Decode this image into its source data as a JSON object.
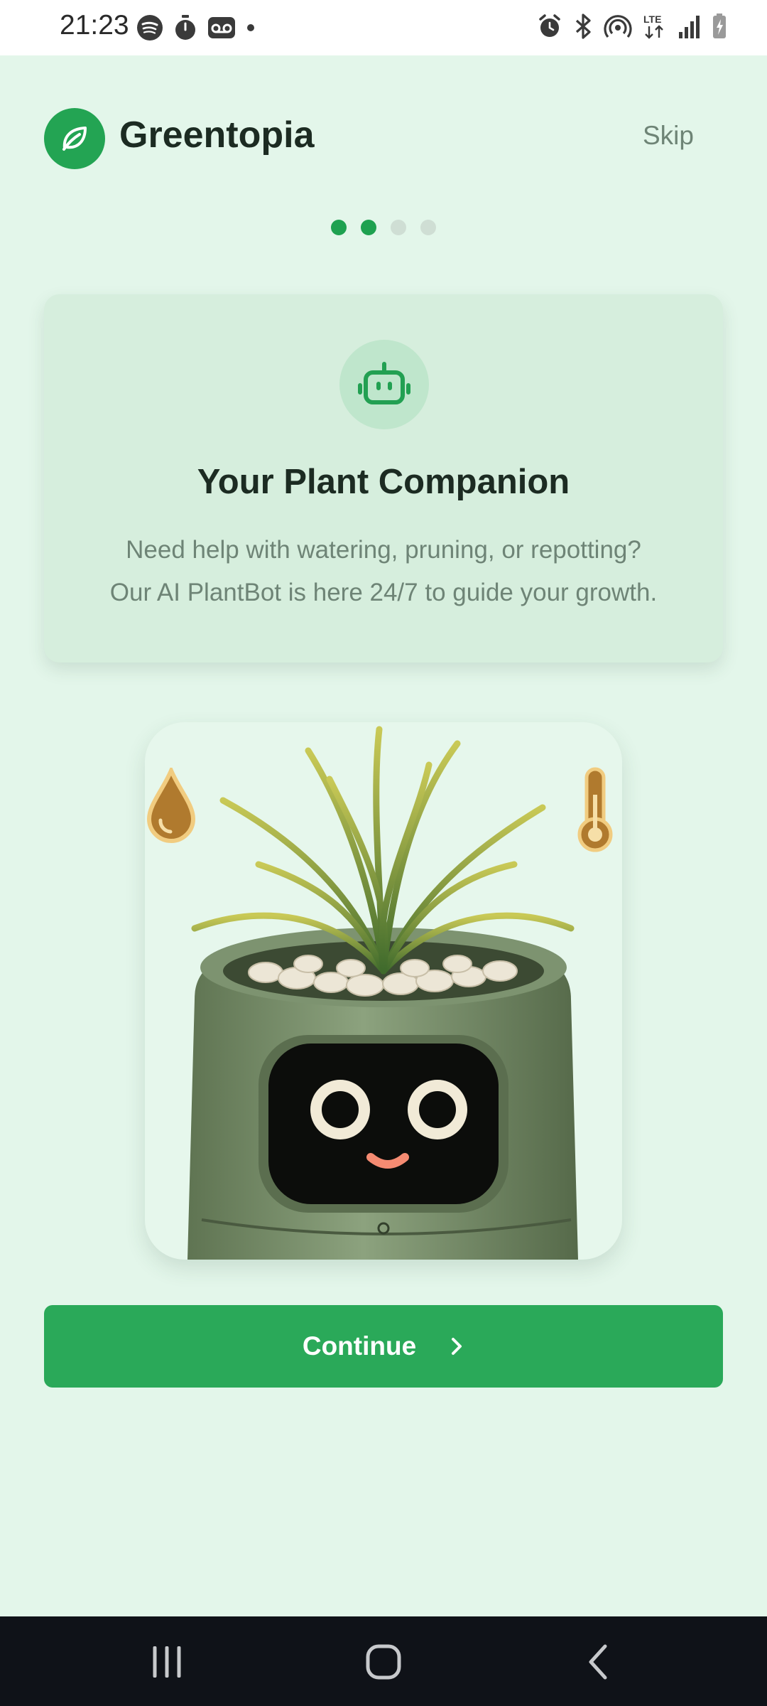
{
  "status_bar": {
    "time": "21:23",
    "left_icons": [
      "spotify-icon",
      "stopwatch-icon",
      "voicemail-icon",
      "dot-icon"
    ],
    "right_icons": [
      "alarm-icon",
      "bluetooth-icon",
      "hotspot-icon",
      "lte-icon",
      "signal-icon",
      "battery-charging-icon"
    ],
    "lte_label": "LTE"
  },
  "header": {
    "app_name": "Greentopia",
    "skip_label": "Skip",
    "logo_icon": "leaf-icon"
  },
  "pagination": {
    "total": 4,
    "active_index": 1
  },
  "feature_card": {
    "icon": "robot-icon",
    "title": "Your Plant Companion",
    "description_line1": "Need help with watering, pruning, or repotting?",
    "description_line2": "Our AI PlantBot is here 24/7 to guide your growth."
  },
  "illustration": {
    "subject": "plant-robot-illustration",
    "badges": [
      "water-drop-icon",
      "thermometer-icon"
    ]
  },
  "continue_button": {
    "label": "Continue",
    "icon": "chevron-right-icon"
  },
  "nav_bar": {
    "buttons": [
      "recent-apps-icon",
      "home-icon",
      "back-icon"
    ]
  },
  "colors": {
    "accent": "#2aa959",
    "background": "#e3f6ea",
    "card": "#d6eedd",
    "text_primary": "#1c2b22",
    "text_secondary": "#6e8476"
  }
}
